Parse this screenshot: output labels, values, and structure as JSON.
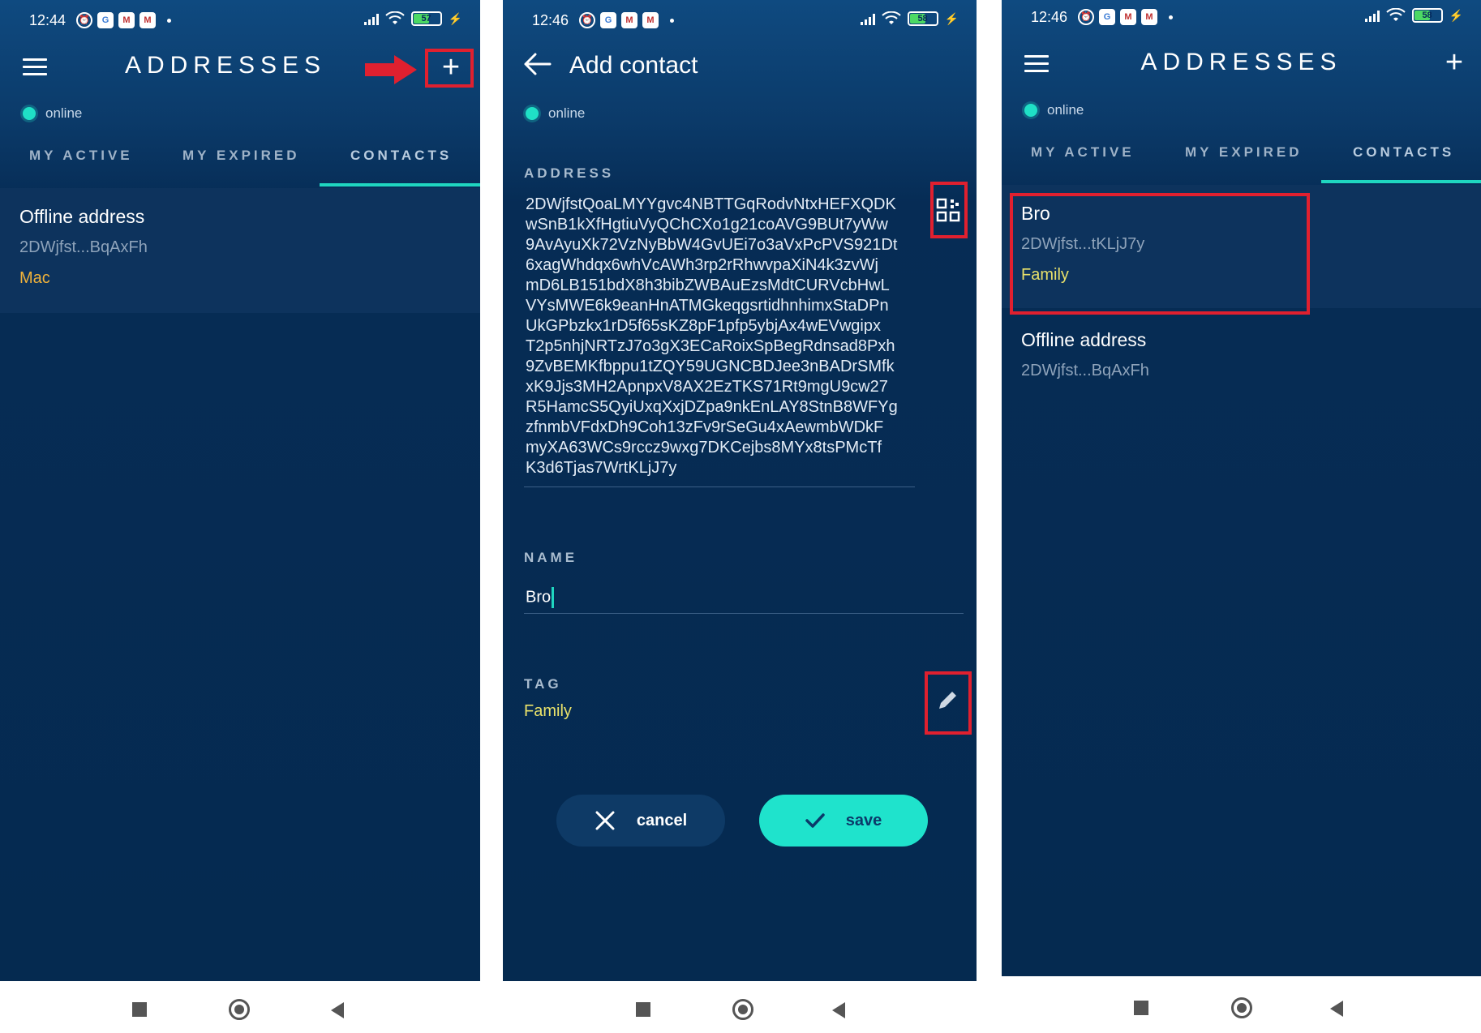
{
  "screens": [
    {
      "time": "12:44",
      "battery": "57",
      "title": "ADDRESSES",
      "status": "online",
      "tabs": [
        "MY ACTIVE",
        "MY EXPIRED",
        "CONTACTS"
      ],
      "active_tab": "CONTACTS",
      "contacts": [
        {
          "name": "Offline address",
          "address": "2DWjfst...BqAxFh",
          "tag": "Mac"
        }
      ]
    },
    {
      "time": "12:46",
      "battery": "58",
      "title": "Add contact",
      "status": "online",
      "address_label": "ADDRESS",
      "address_lines": [
        "2DWjfstQoaLMYYgvc4NBTTGqRodvNtxHEFXQDK",
        "wSnB1kXfHgtiuVyQChCXo1g21coAVG9BUt7yWw",
        "9AvAyuXk72VzNyBbW4GvUEi7o3aVxPcPVS921Dt",
        "6xagWhdqx6whVcAWh3rp2rRhwvpaXiN4k3zvWj",
        "mD6LB151bdX8h3bibZWBAuEzsMdtCURVcbHwL",
        "VYsMWE6k9eanHnATMGkeqgsrtidhnhimxStaDPn",
        "UkGPbzkx1rD5f65sKZ8pF1pfp5ybjAx4wEVwgipx",
        "T2p5nhjNRTzJ7o3gX3ECaRoixSpBegRdnsad8Pxh",
        "9ZvBEMKfbppu1tZQY59UGNCBDJee3nBADrSMfk",
        "xK9Jjs3MH2ApnpxV8AX2EzTKS71Rt9mgU9cw27",
        "R5HamcS5QyiUxqXxjDZpa9nkEnLAY8StnB8WFYg",
        "zfnmbVFdxDh9Coh13zFv9rSeGu4xAewmbWDkF",
        "myXA63WCs9rccz9wxg7DKCejbs8MYx8tsPMcTf",
        "K3d6Tjas7WrtKLjJ7y"
      ],
      "name_label": "NAME",
      "name_value": "Bro",
      "tag_label": "TAG",
      "tag_value": "Family",
      "cancel_label": "cancel",
      "save_label": "save"
    },
    {
      "time": "12:46",
      "battery": "58",
      "title": "ADDRESSES",
      "status": "online",
      "tabs": [
        "MY ACTIVE",
        "MY EXPIRED",
        "CONTACTS"
      ],
      "active_tab": "CONTACTS",
      "contacts": [
        {
          "name": "Bro",
          "address": "2DWjfst...tKLjJ7y",
          "tag": "Family"
        },
        {
          "name": "Offline address",
          "address": "2DWjfst...BqAxFh",
          "tag": ""
        }
      ]
    }
  ],
  "colors": {
    "accent": "#1fd6c0",
    "background": "#052a50",
    "highlight_box": "#e0202f",
    "tag_mac": "#f0b23a",
    "tag_family": "#e9e16a"
  },
  "icons": [
    "menu-icon",
    "plus-icon",
    "back-arrow-icon",
    "qr-code-icon",
    "edit-pencil-icon",
    "close-icon",
    "check-icon",
    "red-arrow-icon"
  ]
}
